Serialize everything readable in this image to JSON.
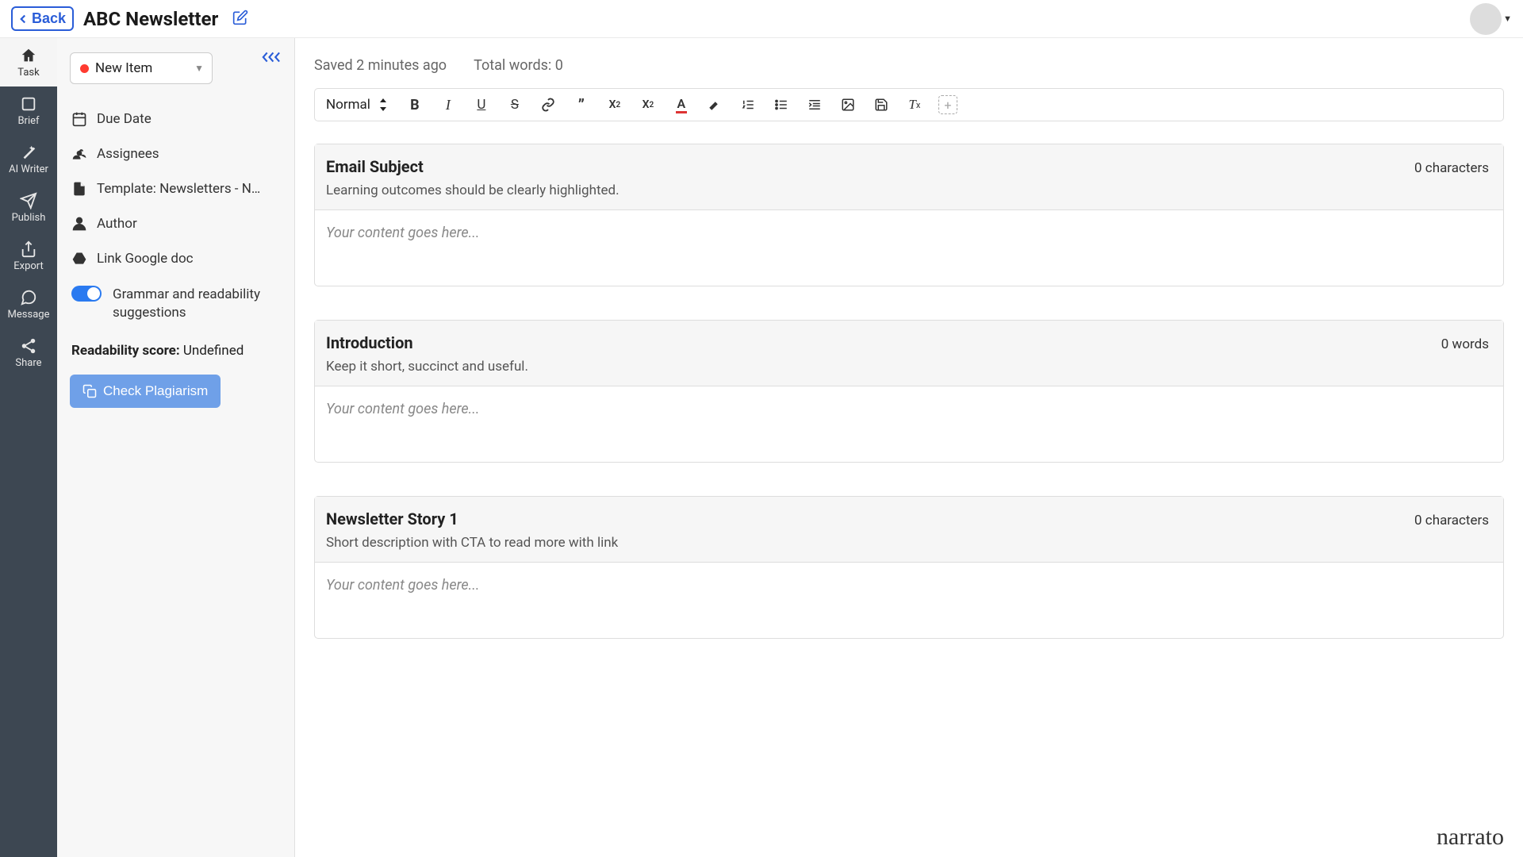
{
  "header": {
    "back": "Back",
    "title": "ABC Newsletter"
  },
  "rail": [
    {
      "label": "Task"
    },
    {
      "label": "Brief"
    },
    {
      "label": "AI Writer"
    },
    {
      "label": "Publish"
    },
    {
      "label": "Export"
    },
    {
      "label": "Message"
    },
    {
      "label": "Share"
    }
  ],
  "sidepanel": {
    "status": "New Item",
    "items": {
      "due_date": "Due Date",
      "assignees": "Assignees",
      "template": "Template: Newsletters - New...",
      "author": "Author",
      "gdoc": "Link Google doc"
    },
    "grammar_toggle": "Grammar and readability suggestions",
    "readability_label": "Readability score:",
    "readability_value": "Undefined",
    "plagiarism": "Check Plagiarism"
  },
  "editor": {
    "saved": "Saved 2 minutes ago",
    "total_words": "Total words: 0",
    "format": "Normal",
    "placeholder": "Your content goes here...",
    "blocks": [
      {
        "title": "Email Subject",
        "count": "0 characters",
        "hint": "Learning outcomes should be clearly highlighted."
      },
      {
        "title": "Introduction",
        "count": "0 words",
        "hint": "Keep it short, succinct and useful."
      },
      {
        "title": "Newsletter Story 1",
        "count": "0 characters",
        "hint": "Short description with CTA to read more with link"
      }
    ]
  },
  "brand": "narrato"
}
